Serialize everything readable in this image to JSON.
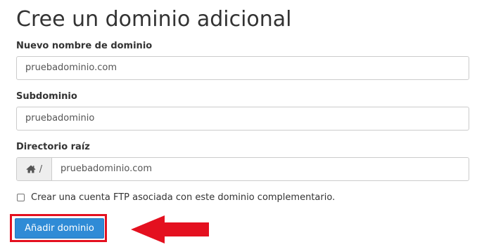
{
  "page": {
    "title": "Cree un dominio adicional"
  },
  "fields": {
    "new_domain": {
      "label": "Nuevo nombre de dominio",
      "value": "pruebadominio.com"
    },
    "subdomain": {
      "label": "Subdominio",
      "value": "pruebadominio"
    },
    "root_directory": {
      "label": "Directorio raíz",
      "prefix_icon": "home-icon",
      "prefix_text": "/",
      "value": "pruebadominio.com"
    }
  },
  "ftp_option": {
    "label": "Crear una cuenta FTP asociada con este dominio complementario.",
    "checked": false
  },
  "submit": {
    "label": "Añadir dominio"
  },
  "annotation": {
    "highlight_color": "#e4101f",
    "arrow_icon": "left-arrow-icon"
  },
  "colors": {
    "button_bg": "#2f8bd6",
    "text": "#333333",
    "input_border": "#cccccc"
  }
}
